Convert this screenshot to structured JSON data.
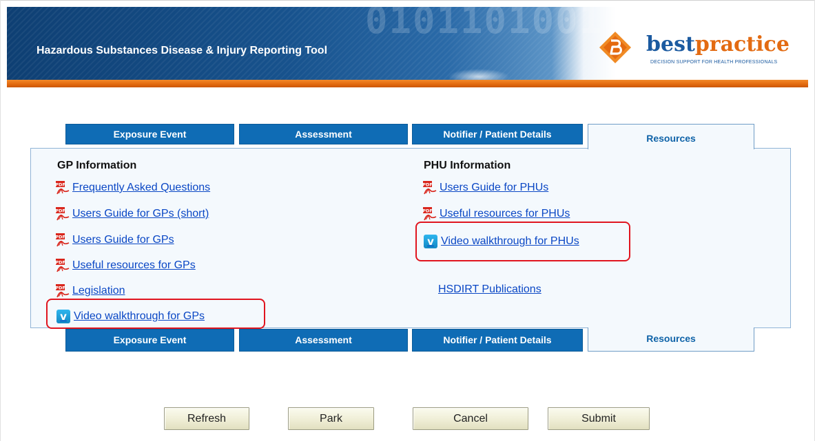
{
  "app": {
    "title": "Hazardous Substances Disease & Injury Reporting Tool",
    "logo": {
      "brand_prefix": "best",
      "brand_accent": "practice",
      "tagline": "DECISION SUPPORT FOR HEALTH PROFESSIONALS"
    }
  },
  "tabs": [
    {
      "label": "Exposure Event",
      "active": false
    },
    {
      "label": "Assessment",
      "active": false
    },
    {
      "label": "Notifier / Patient Details",
      "active": false
    },
    {
      "label": "Resources",
      "active": true
    }
  ],
  "gp": {
    "heading": "GP Information",
    "links": [
      {
        "label": "Frequently Asked Questions",
        "icon": "pdf-icon"
      },
      {
        "label": "Users Guide for GPs (short)",
        "icon": "pdf-icon"
      },
      {
        "label": "Users Guide for GPs",
        "icon": "pdf-icon"
      },
      {
        "label": "Useful resources for GPs",
        "icon": "pdf-icon"
      },
      {
        "label": "Legislation",
        "icon": "pdf-icon"
      },
      {
        "label": "Video walkthrough for GPs",
        "icon": "vimeo-icon"
      }
    ]
  },
  "phu": {
    "heading": "PHU Information",
    "links": [
      {
        "label": "Users Guide for PHUs",
        "icon": "pdf-icon"
      },
      {
        "label": "Useful resources for PHUs",
        "icon": "pdf-icon"
      },
      {
        "label": "Video walkthrough for PHUs",
        "icon": "vimeo-icon"
      }
    ],
    "publications_label": "HSDIRT Publications"
  },
  "vimeo_glyph": "v",
  "buttons": {
    "refresh": "Refresh",
    "park": "Park",
    "cancel": "Cancel",
    "submit": "Submit"
  },
  "colors": {
    "tab_blue": "#0f6cb5",
    "link_blue": "#0a47c5",
    "highlight_red": "#e0141e",
    "header_orange": "#e2690e"
  }
}
